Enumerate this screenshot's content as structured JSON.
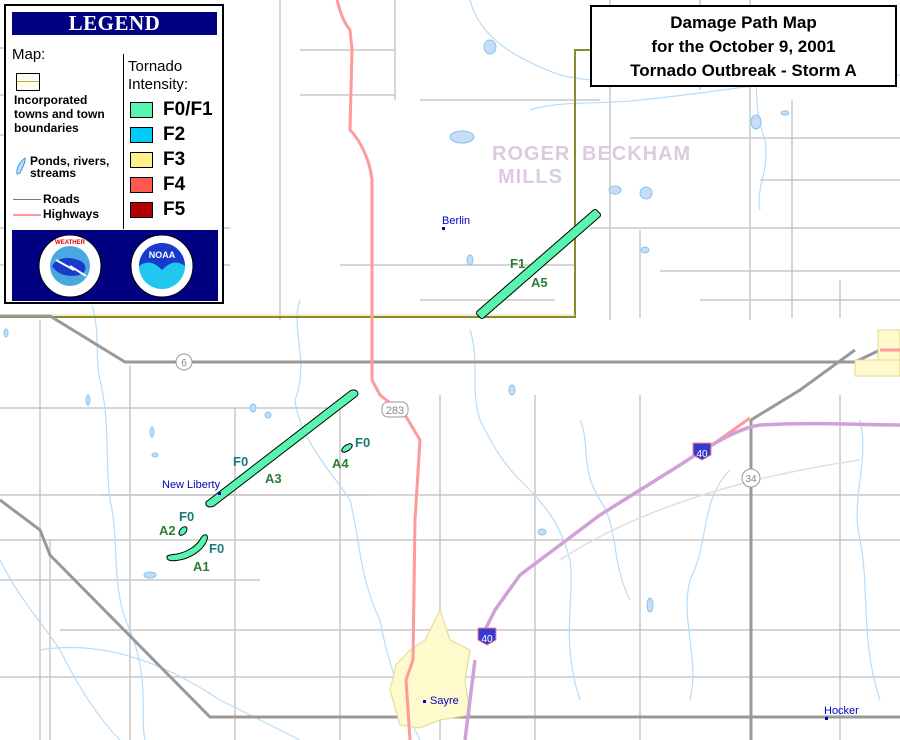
{
  "title": {
    "line1": "Damage Path Map",
    "line2": "for the October 9, 2001",
    "line3": "Tornado Outbreak - Storm A"
  },
  "legend": {
    "header": "LEGEND",
    "map_heading": "Map:",
    "towns_label_1": "Incorporated",
    "towns_label_2": "towns  and town",
    "towns_label_3": "boundaries",
    "water_label_1": "Ponds, rivers,",
    "water_label_2": "streams",
    "roads_label": "Roads",
    "highways_label": "Highways",
    "intensity_heading_1": "Tornado",
    "intensity_heading_2": "Intensity:",
    "intensity": [
      {
        "label": "F0/F1",
        "color": "#57f5b0"
      },
      {
        "label": "F2",
        "color": "#00ccf5"
      },
      {
        "label": "F3",
        "color": "#fff08a"
      },
      {
        "label": "F4",
        "color": "#ff5a50"
      },
      {
        "label": "F5",
        "color": "#b00000"
      }
    ],
    "logos": [
      "National Weather Service",
      "NOAA"
    ],
    "nws_logo_text": "NATIONAL WEATHER SERVICE",
    "noaa_logo_text": "NOAA"
  },
  "map": {
    "counties": {
      "left": "ROGER",
      "left2": "MILLS",
      "right": "BECKHAM"
    },
    "places": [
      "Berlin",
      "New Liberty",
      "Sayre",
      "Hocker"
    ],
    "route_shields": {
      "us283": "283",
      "sh6": "6",
      "sh34": "34",
      "i40a": "40",
      "i40b": "40"
    },
    "tracks": [
      {
        "id": "A1",
        "rating": "F0"
      },
      {
        "id": "A2",
        "rating": "F0"
      },
      {
        "id": "A3",
        "rating": "F0"
      },
      {
        "id": "A4",
        "rating": "F0"
      },
      {
        "id": "A5",
        "rating": "F1"
      }
    ],
    "colors": {
      "track": "#57f5b0",
      "road": "#c8c8c8",
      "major_road": "#999999",
      "highway": "#ff9a9a",
      "interstate": "#d0a0d8",
      "water": "#a8d8f8",
      "county_line": "#8a8a2a",
      "town": "#fffacc"
    }
  }
}
